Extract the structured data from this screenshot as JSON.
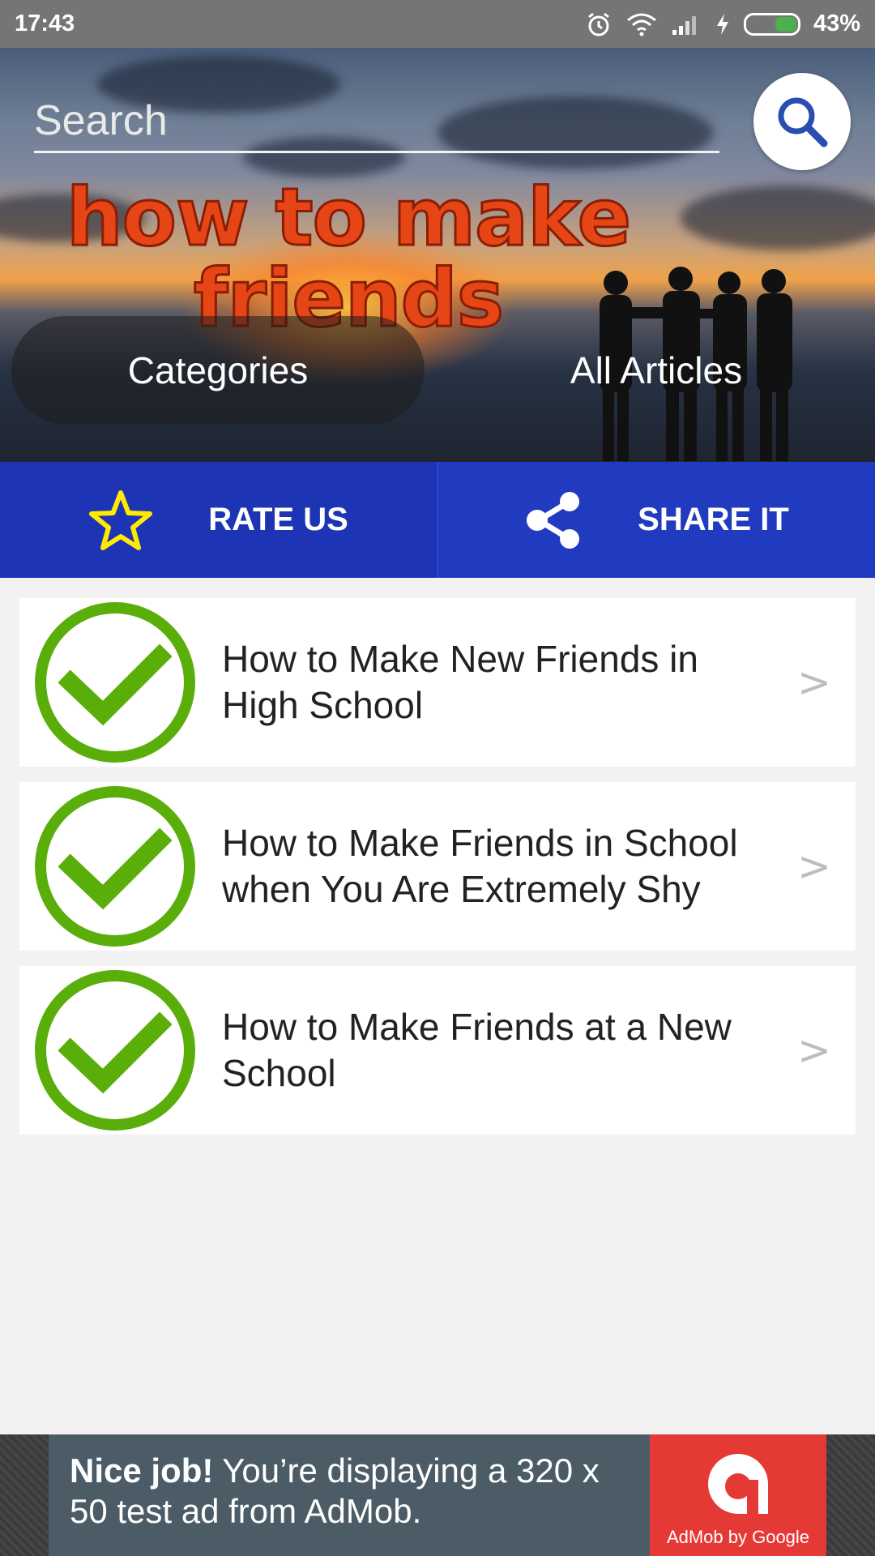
{
  "status_bar": {
    "time": "17:43",
    "battery": "43%",
    "icons": [
      "alarm-icon",
      "wifi-icon",
      "signal-icon",
      "charging-icon",
      "battery-icon"
    ]
  },
  "header": {
    "search": {
      "placeholder": "Search",
      "value": ""
    },
    "search_icon": "search-icon",
    "logo_line1": "how to make",
    "logo_line2": "friends",
    "categories_label": "Categories",
    "all_articles_label": "All Articles"
  },
  "actions": {
    "rate": {
      "label": "RATE US",
      "icon": "star-icon"
    },
    "share": {
      "label": "SHARE IT",
      "icon": "share-icon"
    }
  },
  "articles": [
    {
      "title": "How to Make New Friends in High School"
    },
    {
      "title": "How to Make Friends in School when You Are Extremely Shy"
    },
    {
      "title": "How to Make Friends at a New School"
    }
  ],
  "chevron": ">",
  "ad": {
    "bold": "Nice job!",
    "text": " You’re displaying a 320 x 50 test ad from AdMob.",
    "logo_caption": "AdMob by Google"
  },
  "colors": {
    "action_bar": "#1d34b5",
    "check_green": "#5aae0a",
    "logo_orange": "#e64616",
    "ad_red": "#e53935"
  }
}
